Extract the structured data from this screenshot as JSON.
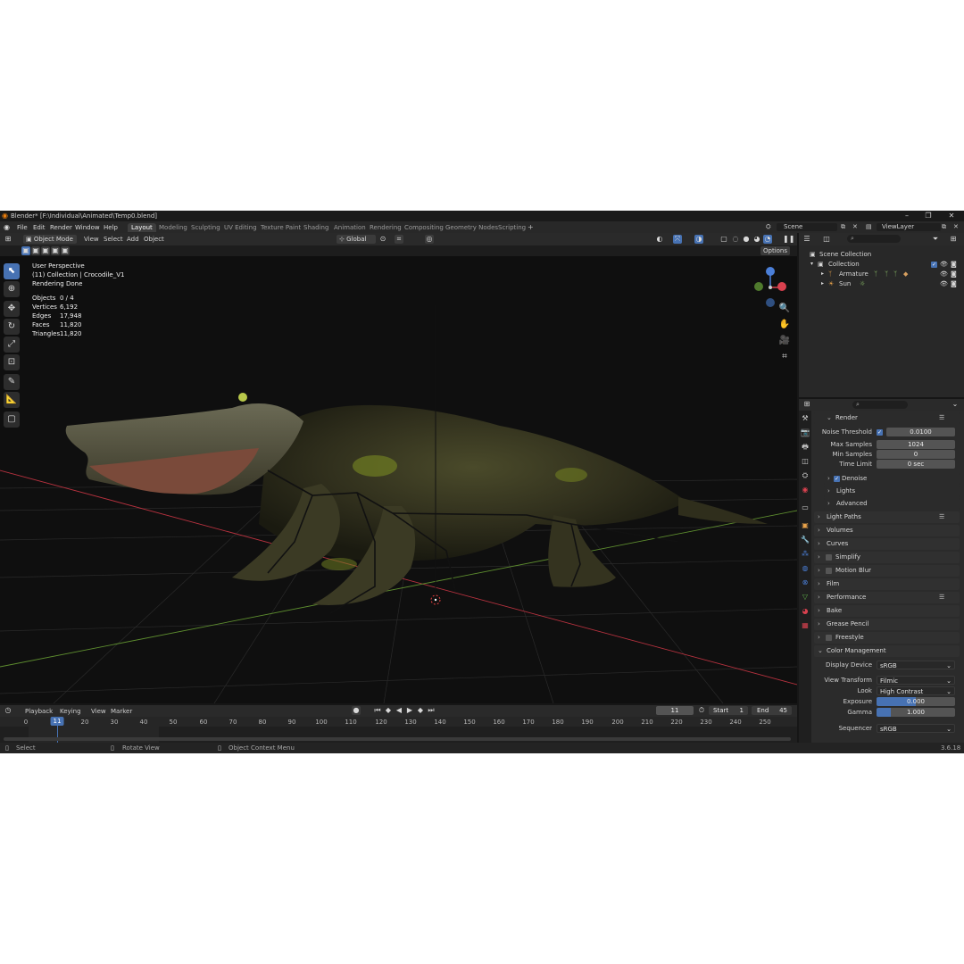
{
  "window": {
    "title": "Blender* [F:\\Individual\\Animated\\Temp0.blend]"
  },
  "menus": [
    "File",
    "Edit",
    "Render",
    "Window",
    "Help"
  ],
  "workspace_tabs": [
    "Layout",
    "Modeling",
    "Sculpting",
    "UV Editing",
    "Texture Paint",
    "Shading",
    "Animation",
    "Rendering",
    "Compositing",
    "Geometry Nodes",
    "Scripting"
  ],
  "scene": {
    "name": "Scene",
    "view_layer": "ViewLayer"
  },
  "viewport_header": {
    "mode": "Object Mode",
    "menus": [
      "View",
      "Select",
      "Add",
      "Object"
    ],
    "orientation": "Global",
    "options": "Options"
  },
  "viewport_overlay": {
    "perspective": "User Perspective",
    "collection": "(11) Collection | Crocodile_V1",
    "status": "Rendering Done",
    "stats": [
      {
        "label": "Objects",
        "value": "0 / 4"
      },
      {
        "label": "Vertices",
        "value": "6,192"
      },
      {
        "label": "Edges",
        "value": "17,948"
      },
      {
        "label": "Faces",
        "value": "11,820"
      },
      {
        "label": "Triangles",
        "value": "11,820"
      }
    ]
  },
  "timeline": {
    "menus": [
      "Playback",
      "Keying",
      "View",
      "Marker"
    ],
    "current_frame": "11",
    "start_label": "Start",
    "start": "1",
    "end_label": "End",
    "end": "45",
    "ticks": [
      "0",
      "11",
      "20",
      "30",
      "40",
      "50",
      "60",
      "70",
      "80",
      "90",
      "100",
      "110",
      "120",
      "130",
      "140",
      "150",
      "160",
      "170",
      "180",
      "190",
      "200",
      "210",
      "220",
      "230",
      "240",
      "250"
    ]
  },
  "statusbar": {
    "select": "Select",
    "rotate": "Rotate View",
    "context": "Object Context Menu",
    "version": "3.6.18"
  },
  "outliner": {
    "scene_collection": "Scene Collection",
    "collection": "Collection",
    "items": [
      "Armature",
      "Sun"
    ]
  },
  "properties": {
    "render_panel": "Render",
    "noise_threshold_label": "Noise Threshold",
    "noise_threshold": "0.0100",
    "max_samples_label": "Max Samples",
    "max_samples": "1024",
    "min_samples_label": "Min Samples",
    "min_samples": "0",
    "time_limit_label": "Time Limit",
    "time_limit": "0 sec",
    "sub_panels": [
      "Denoise",
      "Lights",
      "Advanced"
    ],
    "panels": [
      "Light Paths",
      "Volumes",
      "Curves",
      "Simplify",
      "Motion Blur",
      "Film",
      "Performance",
      "Bake",
      "Grease Pencil",
      "Freestyle",
      "Color Management"
    ],
    "color_management": {
      "display_device_label": "Display Device",
      "display_device": "sRGB",
      "view_transform_label": "View Transform",
      "view_transform": "Filmic",
      "look_label": "Look",
      "look": "High Contrast",
      "exposure_label": "Exposure",
      "exposure": "0.000",
      "gamma_label": "Gamma",
      "gamma": "1.000",
      "sequencer_label": "Sequencer",
      "sequencer": "sRGB"
    }
  },
  "colors": {
    "accent": "#4772b3",
    "x_axis": "#d9414f",
    "y_axis": "#7ab04b",
    "z_axis": "#4b7fd8"
  }
}
